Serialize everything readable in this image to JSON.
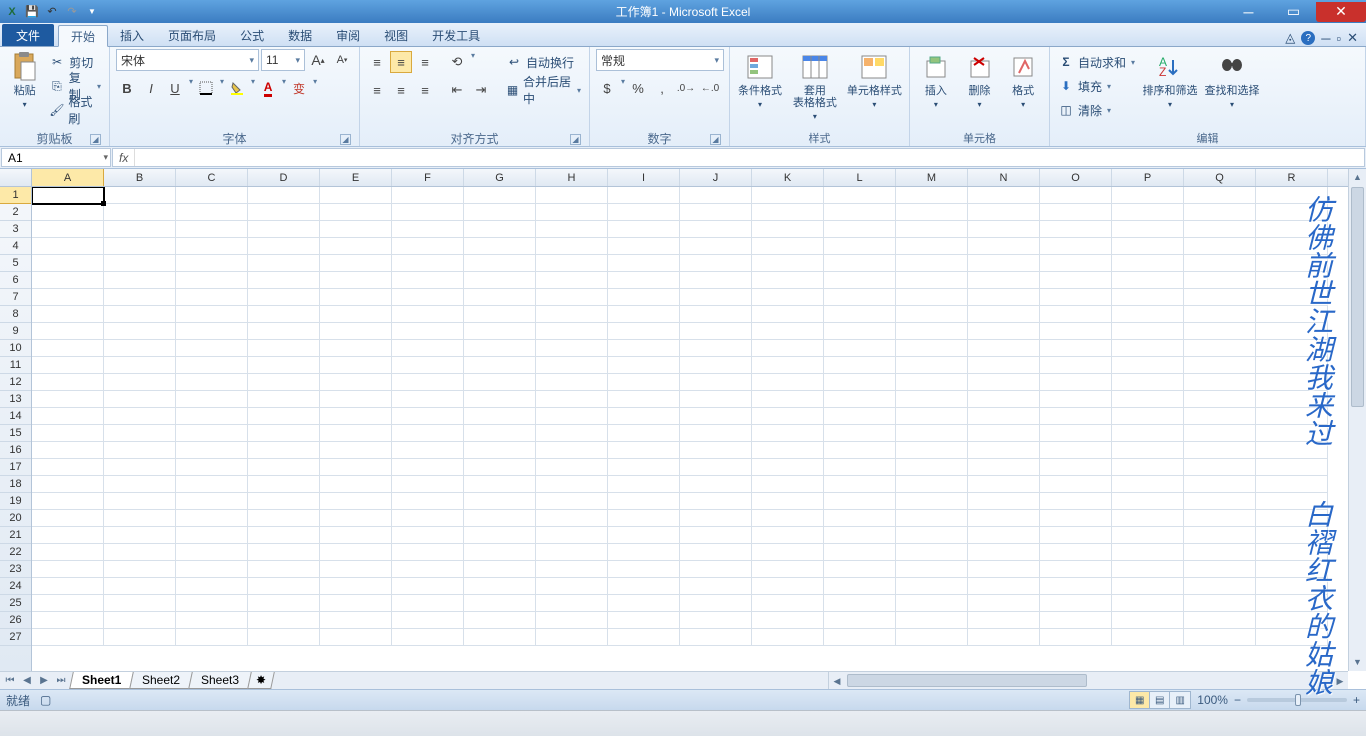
{
  "title": "工作簿1 - Microsoft Excel",
  "qat": {
    "save": "💾",
    "undo": "↶",
    "redo": "↷"
  },
  "tabs": {
    "file": "文件",
    "items": [
      "开始",
      "插入",
      "页面布局",
      "公式",
      "数据",
      "审阅",
      "视图",
      "开发工具"
    ],
    "active": 0
  },
  "ribbon": {
    "clipboard": {
      "paste": "粘贴",
      "cut": "剪切",
      "copy": "复制",
      "format_painter": "格式刷",
      "label": "剪贴板"
    },
    "font": {
      "name": "宋体",
      "size": "11",
      "bold": "B",
      "italic": "I",
      "underline": "U",
      "label": "字体",
      "grow": "A",
      "shrink": "A",
      "phonetic": "变"
    },
    "align": {
      "wrap": "自动换行",
      "merge": "合并后居中",
      "label": "对齐方式"
    },
    "number": {
      "format": "常规",
      "label": "数字"
    },
    "styles": {
      "cond": "条件格式",
      "table": "套用\n表格格式",
      "cell": "单元格样式",
      "label": "样式"
    },
    "cells": {
      "insert": "插入",
      "delete": "删除",
      "format": "格式",
      "label": "单元格"
    },
    "editing": {
      "sum": "自动求和",
      "fill": "填充",
      "clear": "清除",
      "sort": "排序和筛选",
      "find": "查找和选择",
      "label": "编辑"
    }
  },
  "namebox": "A1",
  "formula": "",
  "columns": [
    "A",
    "B",
    "C",
    "D",
    "E",
    "F",
    "G",
    "H",
    "I",
    "J",
    "K",
    "L",
    "M",
    "N",
    "O",
    "P",
    "Q",
    "R"
  ],
  "rows": 27,
  "active_cell": {
    "r": 0,
    "c": 0
  },
  "sheets": {
    "items": [
      "Sheet1",
      "Sheet2",
      "Sheet3"
    ],
    "active": 0
  },
  "status": {
    "ready": "就绪",
    "zoom": "100%"
  },
  "watermark": {
    "l1": "仿佛前世江湖我来过",
    "l2": "白褶红衣的姑娘"
  }
}
